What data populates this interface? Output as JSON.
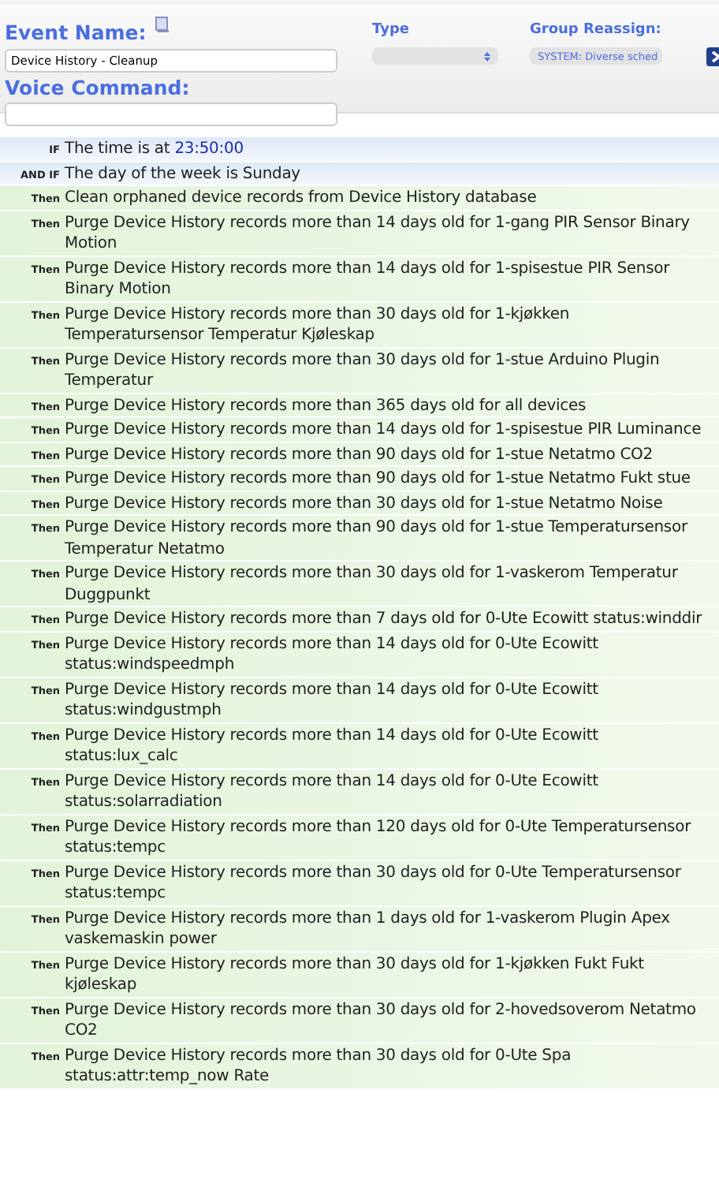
{
  "event": {
    "name_label": "Event Name:",
    "name_value": "Device History - Cleanup",
    "type_label": "Type",
    "group_label": "Group Reassign:",
    "group_value": "SYSTEM: Diverse sched",
    "voice_label": "Voice Command:"
  },
  "rows": [
    {
      "kind": "condition",
      "label": "IF",
      "text": "The time is at",
      "value": "23:50:00"
    },
    {
      "kind": "condition",
      "label": "AND IF",
      "text": "The day of the week is Sunday"
    },
    {
      "kind": "action",
      "label": "Then",
      "text": "Clean orphaned device records from Device History database"
    },
    {
      "kind": "action",
      "label": "Then",
      "text": "Purge Device History records more than 14 days old for 1-gang PIR Sensor Binary Motion"
    },
    {
      "kind": "action",
      "label": "Then",
      "text": "Purge Device History records more than 14 days old for 1-spisestue PIR Sensor Binary Motion"
    },
    {
      "kind": "action",
      "label": "Then",
      "text": "Purge Device History records more than 30 days old for 1-kjøkken Temperatursensor Temperatur Kjøleskap"
    },
    {
      "kind": "action",
      "label": "Then",
      "text": "Purge Device History records more than 30 days old for 1-stue Arduino Plugin Temperatur"
    },
    {
      "kind": "action",
      "label": "Then",
      "text": "Purge Device History records more than 365 days old for all devices"
    },
    {
      "kind": "action",
      "label": "Then",
      "text": "Purge Device History records more than 14 days old for 1-spisestue PIR Luminance"
    },
    {
      "kind": "action",
      "label": "Then",
      "text": "Purge Device History records more than 90 days old for 1-stue Netatmo CO2"
    },
    {
      "kind": "action",
      "label": "Then",
      "text": "Purge Device History records more than 90 days old for 1-stue Netatmo Fukt stue"
    },
    {
      "kind": "action",
      "label": "Then",
      "text": "Purge Device History records more than 30 days old for 1-stue Netatmo Noise"
    },
    {
      "kind": "action",
      "label": "Then",
      "text": "Purge Device History records more than 90 days old for 1-stue Temperatursensor Temperatur Netatmo"
    },
    {
      "kind": "action",
      "label": "Then",
      "text": "Purge Device History records more than 30 days old for 1-vaskerom Temperatur Duggpunkt"
    },
    {
      "kind": "action",
      "label": "Then",
      "text": "Purge Device History records more than 7 days old for 0-Ute Ecowitt status:winddir"
    },
    {
      "kind": "action",
      "label": "Then",
      "text": "Purge Device History records more than 14 days old for 0-Ute Ecowitt status:windspeedmph"
    },
    {
      "kind": "action",
      "label": "Then",
      "text": "Purge Device History records more than 14 days old for 0-Ute Ecowitt status:windgustmph"
    },
    {
      "kind": "action",
      "label": "Then",
      "text": "Purge Device History records more than 14 days old for 0-Ute Ecowitt status:lux_calc"
    },
    {
      "kind": "action",
      "label": "Then",
      "text": "Purge Device History records more than 14 days old for 0-Ute Ecowitt status:solarradiation"
    },
    {
      "kind": "action",
      "label": "Then",
      "text": "Purge Device History records more than 120 days old for 0-Ute Temperatursensor status:tempc"
    },
    {
      "kind": "action",
      "label": "Then",
      "text": "Purge Device History records more than 30 days old for 0-Ute Temperatursensor status:tempc"
    },
    {
      "kind": "action",
      "label": "Then",
      "text": "Purge Device History records more than 1 days old for 1-vaskerom Plugin Apex vaskemaskin power"
    },
    {
      "kind": "action",
      "label": "Then",
      "text": "Purge Device History records more than 30 days old for 1-kjøkken Fukt Fukt kjøleskap"
    },
    {
      "kind": "action",
      "label": "Then",
      "text": "Purge Device History records more than 30 days old for 2-hovedsoverom Netatmo CO2"
    },
    {
      "kind": "action",
      "label": "Then",
      "text": "Purge Device History records more than 30 days old for 0-Ute Spa status:attr:temp_now Rate"
    }
  ]
}
